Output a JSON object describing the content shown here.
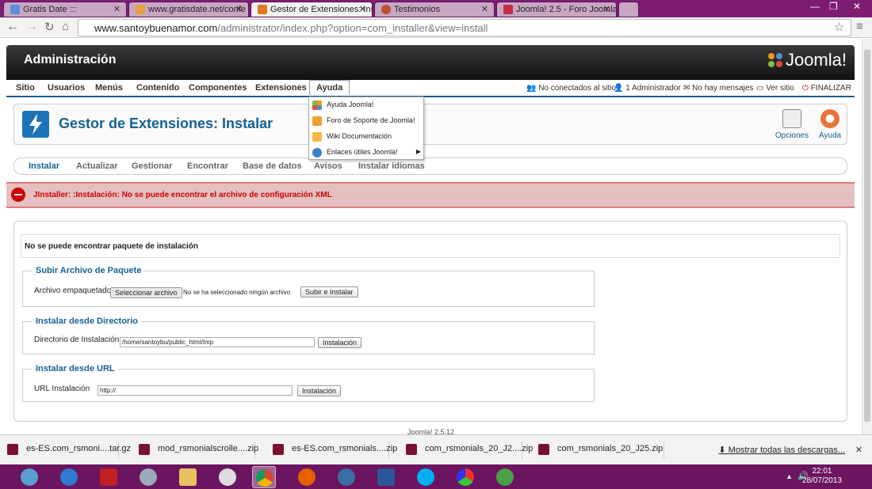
{
  "browser": {
    "tabs": [
      {
        "title": "Gratis Date :::",
        "color": "#5b8fd6"
      },
      {
        "title": "www.gratisdate.net/confe",
        "color": "#e8a040"
      },
      {
        "title": "Gestor de Extensiones: Insta",
        "color": "#e07a1f"
      },
      {
        "title": "Testimonios",
        "color": "#c05030"
      },
      {
        "title": "Joomla! 2.5 - Foro Joomla!",
        "color": "#c03040"
      }
    ],
    "url_host": "www.santoybuenamor.com",
    "url_path": "/administrator/index.php?option=com_installer&view=install"
  },
  "header": {
    "title": "Administración",
    "logo": "Joomla!"
  },
  "menu": {
    "items": [
      "Sitio",
      "Usuarios",
      "Menús",
      "Contenido",
      "Componentes",
      "Extensiones",
      "Ayuda"
    ],
    "status": [
      "No conectados al sitio",
      "1 Administrador",
      "No hay mensajes",
      "Ver sitio",
      "FINALIZAR"
    ]
  },
  "dropdown": {
    "items": [
      "Ayuda Joomla!",
      "Foro de Soporte de Joomla!",
      "Wiki Documentación",
      "Enlaces útiles Joomla!"
    ]
  },
  "toolbar": {
    "title": "Gestor de Extensiones: Instalar",
    "options": "Opciones",
    "help": "Ayuda"
  },
  "subtabs": [
    "Instalar",
    "Actualizar",
    "Gestionar",
    "Encontrar",
    "Base de datos",
    "Avisos",
    "Instalar idiomas"
  ],
  "error": "JInstaller: :Instalación: No se puede encontrar el archivo de configuración XML",
  "notice": "No se puede encontrar paquete de instalación",
  "upload": {
    "legend": "Subir Archivo de Paquete",
    "label": "Archivo empaquetado",
    "choose": "Seleccionar archivo",
    "no_file": "No se ha seleccionado ningún archivo",
    "submit": "Subir e Instalar"
  },
  "directory": {
    "legend": "Instalar desde Directorio",
    "label": "Directorio de Instalación",
    "value": "/home/santoybu/public_html/tmp",
    "submit": "Instalación"
  },
  "url": {
    "legend": "Instalar desde URL",
    "label": "URL Instalación",
    "value": "http://",
    "submit": "Instalación"
  },
  "footer": "Joomla! 2.5.12",
  "downloads": {
    "items": [
      "es-ES.com_rsmoni....tar.gz",
      "mod_rsmonialscrolle....zip",
      "es-ES.com_rsmonials....zip",
      "com_rsmonials_20_J2....zip",
      "com_rsmonials_20_J25.zip"
    ],
    "show_all": "Mostrar todas las descargas..."
  },
  "taskbar": {
    "time": "22:01",
    "date": "28/07/2013"
  }
}
